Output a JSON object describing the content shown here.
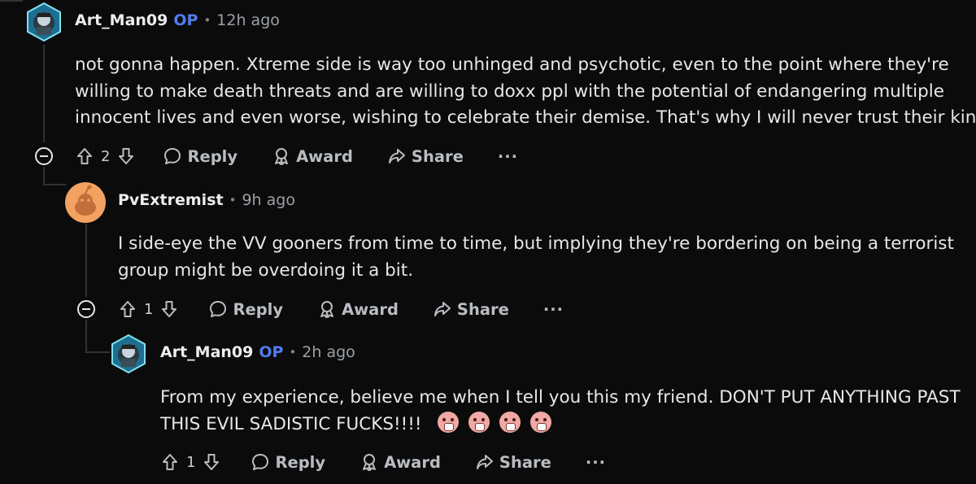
{
  "comments": [
    {
      "username": "Art_Man09",
      "op_badge": "OP",
      "separator": "•",
      "time": "12h ago",
      "lines": [
        "not gonna happen. Xtreme side is way too unhinged and psychotic, even to the point where they're",
        "willing to make death threats and are willing to doxx ppl with the potential of endangering multiple",
        "innocent lives and even worse, wishing to celebrate their demise. That's why I will never trust their kind."
      ],
      "votes": "2",
      "reply_label": "Reply",
      "award_label": "Award",
      "share_label": "Share",
      "more_label": "···"
    },
    {
      "username": "PvExtremist",
      "separator": "•",
      "time": "9h ago",
      "lines": [
        "I side-eye the VV gooners from time to time, but implying they're bordering on being a terrorist",
        "group might be overdoing it a bit."
      ],
      "votes": "1",
      "reply_label": "Reply",
      "award_label": "Award",
      "share_label": "Share",
      "more_label": "···"
    },
    {
      "username": "Art_Man09",
      "op_badge": "OP",
      "separator": "•",
      "time": "2h ago",
      "lines": [
        "From my experience, believe me when I tell you this my friend. DON'T PUT ANYTHING PAST",
        "THIS EVIL SADISTIC FUCKS!!!!"
      ],
      "emojis": [
        "fearful-face",
        "fearful-face",
        "fearful-face",
        "fearful-face"
      ],
      "votes": "1",
      "reply_label": "Reply",
      "award_label": "Award",
      "share_label": "Share",
      "more_label": "···"
    }
  ],
  "colors": {
    "background": "#0b0b0c",
    "op_badge": "#4f7df0",
    "text": "#e5e7e9",
    "meta": "#9aa0a6"
  }
}
